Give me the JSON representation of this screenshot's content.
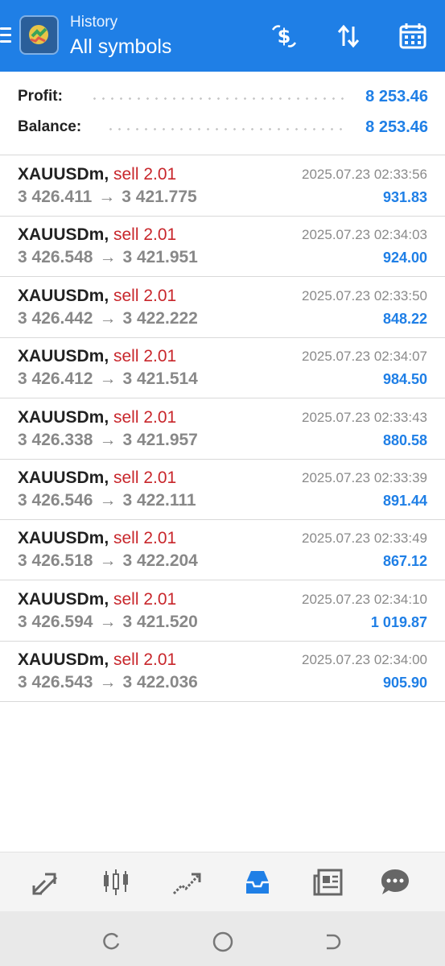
{
  "header": {
    "subtitle": "History",
    "title": "All symbols",
    "icons": [
      "menu-icon",
      "app-logo",
      "deposit-icon",
      "sort-icon",
      "calendar-icon"
    ]
  },
  "summary": {
    "profit_label": "Profit:",
    "profit_value": "8 253.46",
    "balance_label": "Balance:",
    "balance_value": "8 253.46"
  },
  "trades": [
    {
      "symbol": "XAUUSDm,",
      "side": "sell 2.01",
      "open": "3 426.411",
      "arrow": "→",
      "close": "3 421.775",
      "time": "2025.07.23 02:33:56",
      "profit": "931.83"
    },
    {
      "symbol": "XAUUSDm,",
      "side": "sell 2.01",
      "open": "3 426.548",
      "arrow": "→",
      "close": "3 421.951",
      "time": "2025.07.23 02:34:03",
      "profit": "924.00"
    },
    {
      "symbol": "XAUUSDm,",
      "side": "sell 2.01",
      "open": "3 426.442",
      "arrow": "→",
      "close": "3 422.222",
      "time": "2025.07.23 02:33:50",
      "profit": "848.22"
    },
    {
      "symbol": "XAUUSDm,",
      "side": "sell 2.01",
      "open": "3 426.412",
      "arrow": "→",
      "close": "3 421.514",
      "time": "2025.07.23 02:34:07",
      "profit": "984.50"
    },
    {
      "symbol": "XAUUSDm,",
      "side": "sell 2.01",
      "open": "3 426.338",
      "arrow": "→",
      "close": "3 421.957",
      "time": "2025.07.23 02:33:43",
      "profit": "880.58"
    },
    {
      "symbol": "XAUUSDm,",
      "side": "sell 2.01",
      "open": "3 426.546",
      "arrow": "→",
      "close": "3 422.111",
      "time": "2025.07.23 02:33:39",
      "profit": "891.44"
    },
    {
      "symbol": "XAUUSDm,",
      "side": "sell 2.01",
      "open": "3 426.518",
      "arrow": "→",
      "close": "3 422.204",
      "time": "2025.07.23 02:33:49",
      "profit": "867.12"
    },
    {
      "symbol": "XAUUSDm,",
      "side": "sell 2.01",
      "open": "3 426.594",
      "arrow": "→",
      "close": "3 421.520",
      "time": "2025.07.23 02:34:10",
      "profit": "1 019.87"
    },
    {
      "symbol": "XAUUSDm,",
      "side": "sell 2.01",
      "open": "3 426.543",
      "arrow": "→",
      "close": "3 422.036",
      "time": "2025.07.23 02:34:00",
      "profit": "905.90"
    }
  ],
  "tabs": [
    {
      "icon": "quotes-icon",
      "active": false
    },
    {
      "icon": "chart-icon",
      "active": false
    },
    {
      "icon": "trade-icon",
      "active": false
    },
    {
      "icon": "history-icon",
      "active": true
    },
    {
      "icon": "news-icon",
      "active": false
    },
    {
      "icon": "chat-icon",
      "active": false
    }
  ],
  "colors": {
    "accent": "#1f7fe6",
    "sell": "#c8262b",
    "muted": "#888888",
    "tab_inactive": "#666666"
  }
}
